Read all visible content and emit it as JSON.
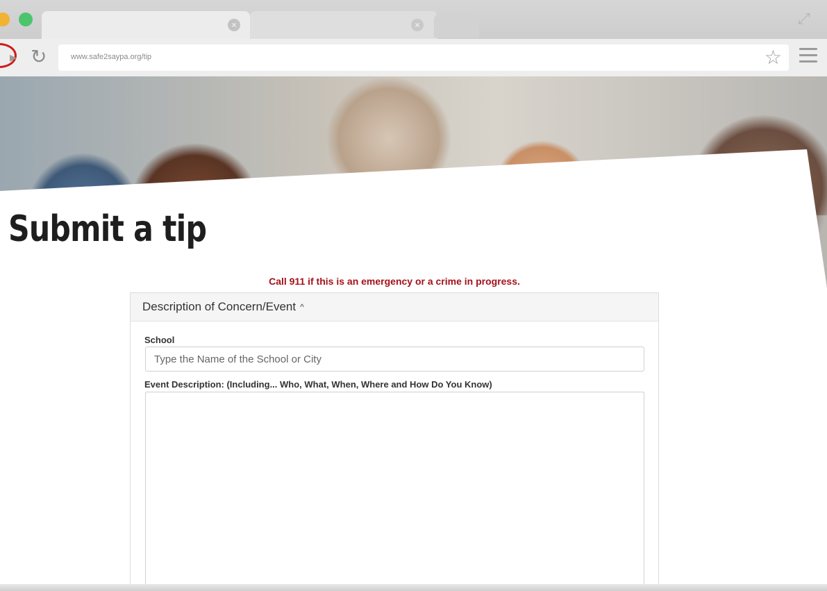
{
  "browser": {
    "url": "www.safe2saypa.org/tip",
    "tab_close_glyph": "×"
  },
  "page": {
    "title": "Submit a tip",
    "emergency_notice": "Call 911 if this is an emergency or a crime in progress."
  },
  "form": {
    "section_title": "Description of Concern/Event",
    "school_label": "School",
    "school_placeholder": "Type the Name of the School or City",
    "description_label": "Event Description: (Including... Who, What, When, Where and How Do You Know)"
  },
  "colors": {
    "alert": "#a3121a",
    "highlight_circle": "#d11a1a"
  }
}
